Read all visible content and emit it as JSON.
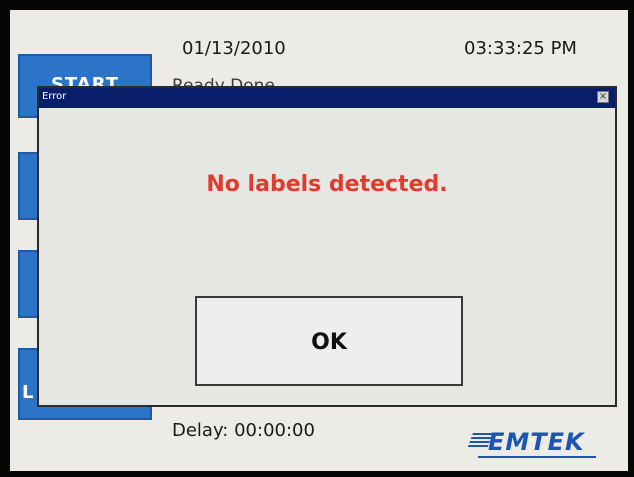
{
  "header": {
    "date": "01/13/2010",
    "time": "03:33:25 PM"
  },
  "background": {
    "start_button_label": "START",
    "status_text": "Ready Done",
    "last_button_label": "L",
    "delay_text": "Delay: 00:00:00",
    "logo_text": "EMTEK",
    "brand_color": "#1d55b4"
  },
  "dialog": {
    "title": "Error",
    "close_glyph": "×",
    "message": "No labels detected.",
    "message_color": "#e23a2e",
    "ok_label": "OK",
    "titlebar_color": "#0a1f6b"
  }
}
